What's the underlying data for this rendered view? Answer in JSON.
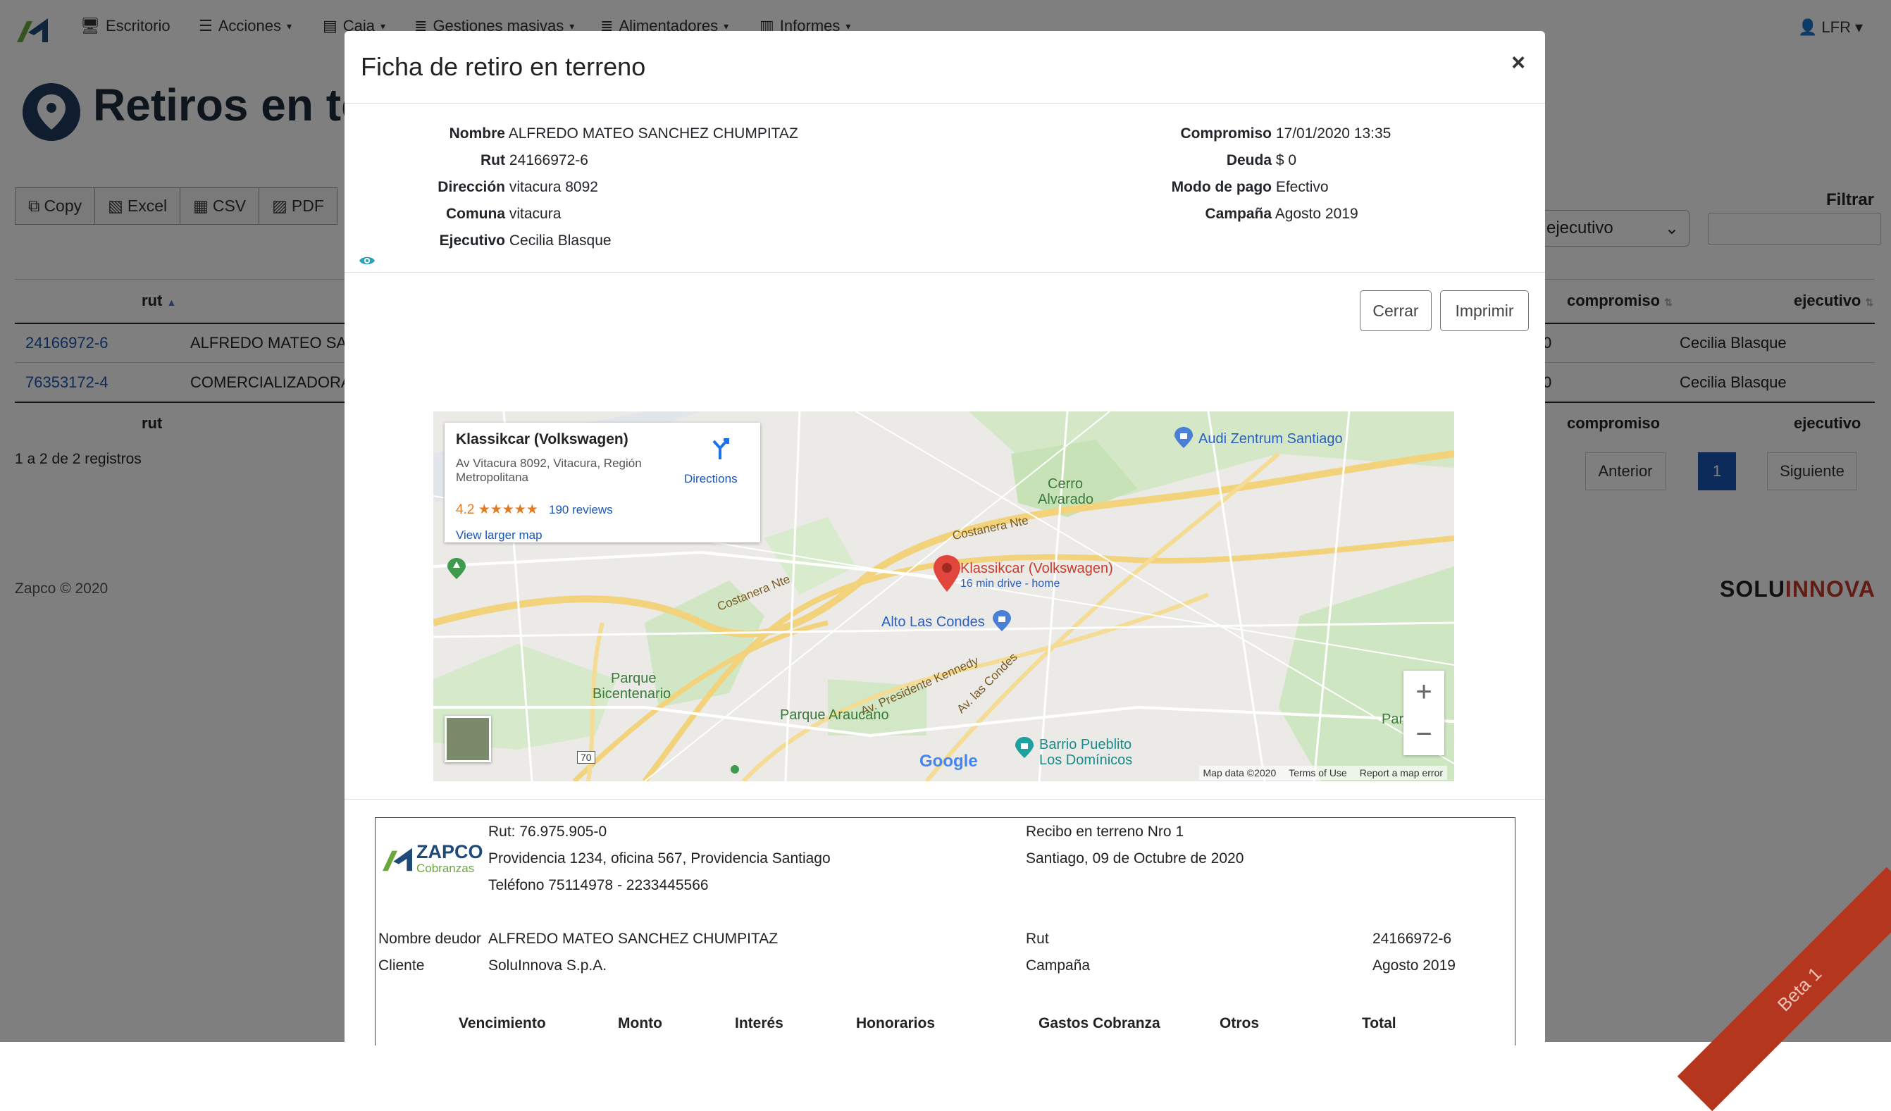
{
  "nav": {
    "items": [
      "Escritorio",
      "Acciones",
      "Caja",
      "Gestiones masivas",
      "Alimentadores",
      "Informes"
    ],
    "user": "LFR"
  },
  "page": {
    "title": "Retiros en terreno"
  },
  "toolbar": {
    "copy": "Copy",
    "excel": "Excel",
    "csv": "CSV",
    "pdf": "PDF"
  },
  "filter": {
    "label": "Filtrar",
    "select_value": "ejecutivo"
  },
  "table": {
    "headers": {
      "rut": "rut",
      "compromiso": "compromiso",
      "ejecutivo": "ejecutivo"
    },
    "rows": [
      {
        "rut": "24166972-6",
        "nombre": "ALFREDO MATEO SANC",
        "comp": "0",
        "ejecutivo": "Cecilia Blasque"
      },
      {
        "rut": "76353172-4",
        "nombre": "COMERCIALIZADORA Y",
        "comp": "0",
        "ejecutivo": "Cecilia Blasque"
      }
    ],
    "records": "1 a 2 de 2 registros",
    "pager": {
      "prev": "Anterior",
      "page": "1",
      "next": "Siguiente"
    }
  },
  "footer": {
    "copyright": "Zapco © 2020",
    "brand_a": "SOLU",
    "brand_b": "INNOVA"
  },
  "ribbon": "Beta 1",
  "modal": {
    "title": "Ficha de retiro en terreno",
    "close": "×",
    "left_fields": [
      {
        "k": "Nombre",
        "v": "ALFREDO MATEO SANCHEZ CHUMPITAZ"
      },
      {
        "k": "Rut",
        "v": "24166972-6"
      },
      {
        "k": "Dirección",
        "v": "vitacura 8092"
      },
      {
        "k": "Comuna",
        "v": "vitacura"
      },
      {
        "k": "Ejecutivo",
        "v": "Cecilia Blasque"
      }
    ],
    "right_fields": [
      {
        "k": "Compromiso",
        "v": "17/01/2020 13:35"
      },
      {
        "k": "Deuda",
        "v": "$ 0"
      },
      {
        "k": "Modo de pago",
        "v": "Efectivo"
      },
      {
        "k": "Campaña",
        "v": "Agosto 2019"
      }
    ],
    "buttons": {
      "close": "Cerrar",
      "print": "Imprimir"
    }
  },
  "map": {
    "card": {
      "title": "Klassikcar (Volkswagen)",
      "address": "Av Vitacura 8092, Vitacura, Región Metropolitana",
      "rating": "4.2",
      "stars": "★★★★★",
      "reviews": "190 reviews",
      "larger": "View larger map",
      "directions": "Directions"
    },
    "labels": {
      "audi": "Audi Zentrum Santiago",
      "cerro_1": "Cerro",
      "cerro_2": "Alvarado",
      "costanera_1": "Costanera Nte",
      "costanera_2": "Costanera Nte",
      "pin_name": "Klassikcar (Volkswagen)",
      "pin_sub": "16 min drive - home",
      "alto": "Alto Las Condes",
      "kennedy": "Av. Presidente Kennedy",
      "las_condes": "Av. las Condes",
      "bicentenario_1": "Parque",
      "bicentenario_2": "Bicentenario",
      "araucano": "Parque Araucano",
      "barrio_1": "Barrio Pueblito",
      "barrio_2": "Los Domínicos",
      "par": "Par",
      "route": "70"
    },
    "attribution": {
      "data": "Map data ©2020",
      "terms": "Terms of Use",
      "report": "Report a map error"
    },
    "google": "Google"
  },
  "receipt": {
    "company_1": "ZAPCO",
    "company_2": "Cobranzas",
    "rut": "Rut: 76.975.905-0",
    "address": "Providencia 1234, oficina 567, Providencia Santiago",
    "phone": "Teléfono 75114978 - 2233445566",
    "receipt_no": "Recibo en terreno Nro 1",
    "date": "Santiago, 09 de Octubre de 2020",
    "deudor_label": "Nombre deudor",
    "deudor": "ALFREDO MATEO SANCHEZ CHUMPITAZ",
    "rut_label": "Rut",
    "rut_val": "24166972-6",
    "cliente_label": "Cliente",
    "cliente": "SoluInnova S.p.A.",
    "campana_label": "Campaña",
    "campana": "Agosto 2019",
    "columns": [
      "Vencimiento",
      "Monto",
      "Interés",
      "Honorarios",
      "Gastos Cobranza",
      "Otros",
      "Total"
    ]
  }
}
